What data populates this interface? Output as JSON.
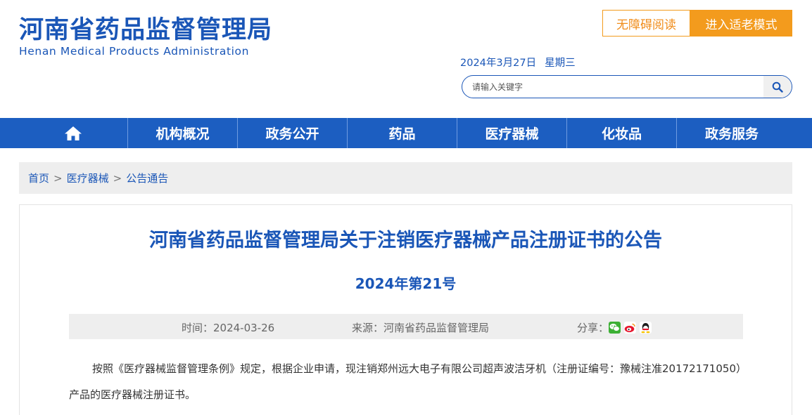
{
  "header": {
    "logo_cn": "河南省药品监督管理局",
    "logo_en": "Henan Medical Products Administration",
    "accessibility_label": "无障碍阅读",
    "elder_mode_label": "进入适老模式",
    "date": "2024年3月27日",
    "weekday": "星期三",
    "search_placeholder": "请输入关键字"
  },
  "nav": {
    "items": [
      {
        "label": "机构概况"
      },
      {
        "label": "政务公开"
      },
      {
        "label": "药品"
      },
      {
        "label": "医疗器械"
      },
      {
        "label": "化妆品"
      },
      {
        "label": "政务服务"
      }
    ]
  },
  "breadcrumb": {
    "items": [
      "首页",
      "医疗器械",
      "公告通告"
    ],
    "separator": ">"
  },
  "article": {
    "title": "河南省药品监督管理局关于注销医疗器械产品注册证书的公告",
    "doc_number": "2024年第21号",
    "time": "时间：2024-03-26",
    "source": "来源：河南省药品监督管理局",
    "share_label": "分享：",
    "body": "按照《医疗器械监督管理条例》规定，根据企业申请，现注销郑州远大电子有限公司超声波洁牙机（注册证编号：豫械注准20172171050）产品的医疗器械注册证书。"
  },
  "colors": {
    "brand_blue": "#1a56b7",
    "nav_blue": "#1c5ec1",
    "accent_orange": "#f39b1d"
  }
}
